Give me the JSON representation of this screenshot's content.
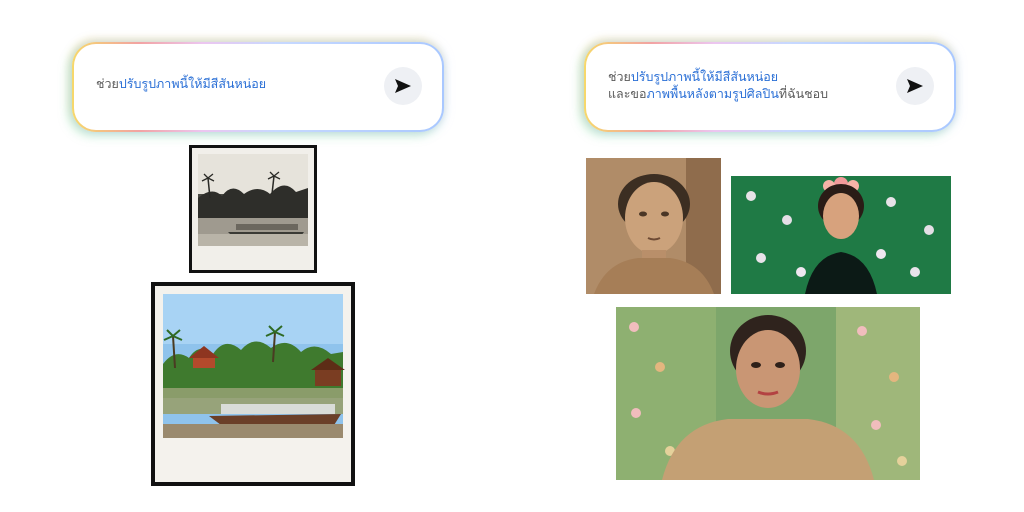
{
  "left_example": {
    "prompt": {
      "part1": "ช่วย",
      "part2": "ปรับรูปภาพนี้ให้มีสีสันหน่อย"
    },
    "send_icon": "send-arrow-icon"
  },
  "right_example": {
    "prompt": {
      "line1_part1": "ช่วย",
      "line1_part2": "ปรับรูปภาพนี้ให้มีสีสันหน่อย",
      "line2_part1": "และขอ",
      "line2_part2": "ภาพพื้นหลังตามรูปศิลปิน",
      "line2_part3": "ที่ฉันชอบ"
    },
    "send_icon": "send-arrow-icon"
  },
  "colors": {
    "accent_blue": "#2a6fd6",
    "text_grey": "#5b5b5b",
    "send_button_bg": "#eef0f4"
  }
}
